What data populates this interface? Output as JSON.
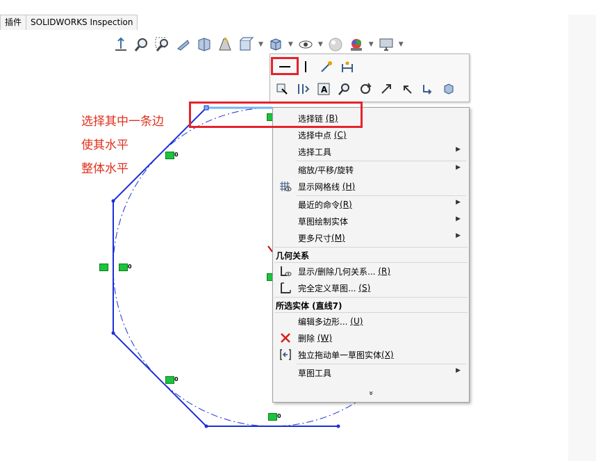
{
  "tabs": [
    {
      "label": "插件"
    },
    {
      "label": "SOLIDWORKS Inspection"
    }
  ],
  "toolbar": {
    "icons": [
      "view-normal-icon",
      "zoom-fit-icon",
      "zoom-area-icon",
      "previous-view-icon",
      "section-view-icon",
      "dynamic-annotation-icon",
      "view-orientation-icon",
      "display-style-icon",
      "hide-show-icon",
      "edit-appearance-icon",
      "apply-scene-icon",
      "view-settings-icon"
    ]
  },
  "annotations": {
    "line1": "选择其中一条边",
    "line2": "使其水平",
    "line3": "整体水平"
  },
  "context_toolbar": {
    "row1": [
      "horizontal-icon",
      "vertical-icon",
      "smart-dimension-icon",
      "horizontal-dimension-icon"
    ],
    "row2": [
      "select-icon",
      "mirror-icon",
      "text-icon",
      "zoom-icon",
      "rotate-icon",
      "pan-icon",
      "undo-arrow-icon",
      "repeat-icon",
      "view-3d-icon"
    ]
  },
  "context_menu": {
    "items": [
      {
        "label": "选择链",
        "key": "(B)"
      },
      {
        "label": "选择中点",
        "key": "(C)"
      },
      {
        "label": "选择工具",
        "key": ""
      },
      {
        "label": "缩放/平移/旋转",
        "key": ""
      },
      {
        "label": "显示网格线",
        "key": "(H)"
      },
      {
        "label": "最近的命令",
        "key": "(R)"
      },
      {
        "label": "草图绘制实体",
        "key": ""
      },
      {
        "label": "更多尺寸",
        "key": "(M)"
      }
    ],
    "section_relations": "几何关系",
    "relations_items": [
      {
        "label": "显示/删除几何关系...",
        "key": "(R)"
      },
      {
        "label": "完全定义草图...",
        "key": "(S)"
      }
    ],
    "section_entity": "所选实体 (直线7)",
    "entity_items": [
      {
        "label": "编辑多边形...",
        "key": "(U)"
      },
      {
        "label": "删除",
        "key": "(W)"
      },
      {
        "label": "独立拖动单一草图实体",
        "key": "(X)"
      },
      {
        "label": "草图工具",
        "key": ""
      }
    ],
    "more": "»"
  },
  "sketch": {
    "tag_value": "0"
  },
  "colors": {
    "sketch_line": "#1a2fd6",
    "highlight": "#e5232c",
    "note_text": "#e0301e",
    "relation_tag": "#19c53c"
  }
}
